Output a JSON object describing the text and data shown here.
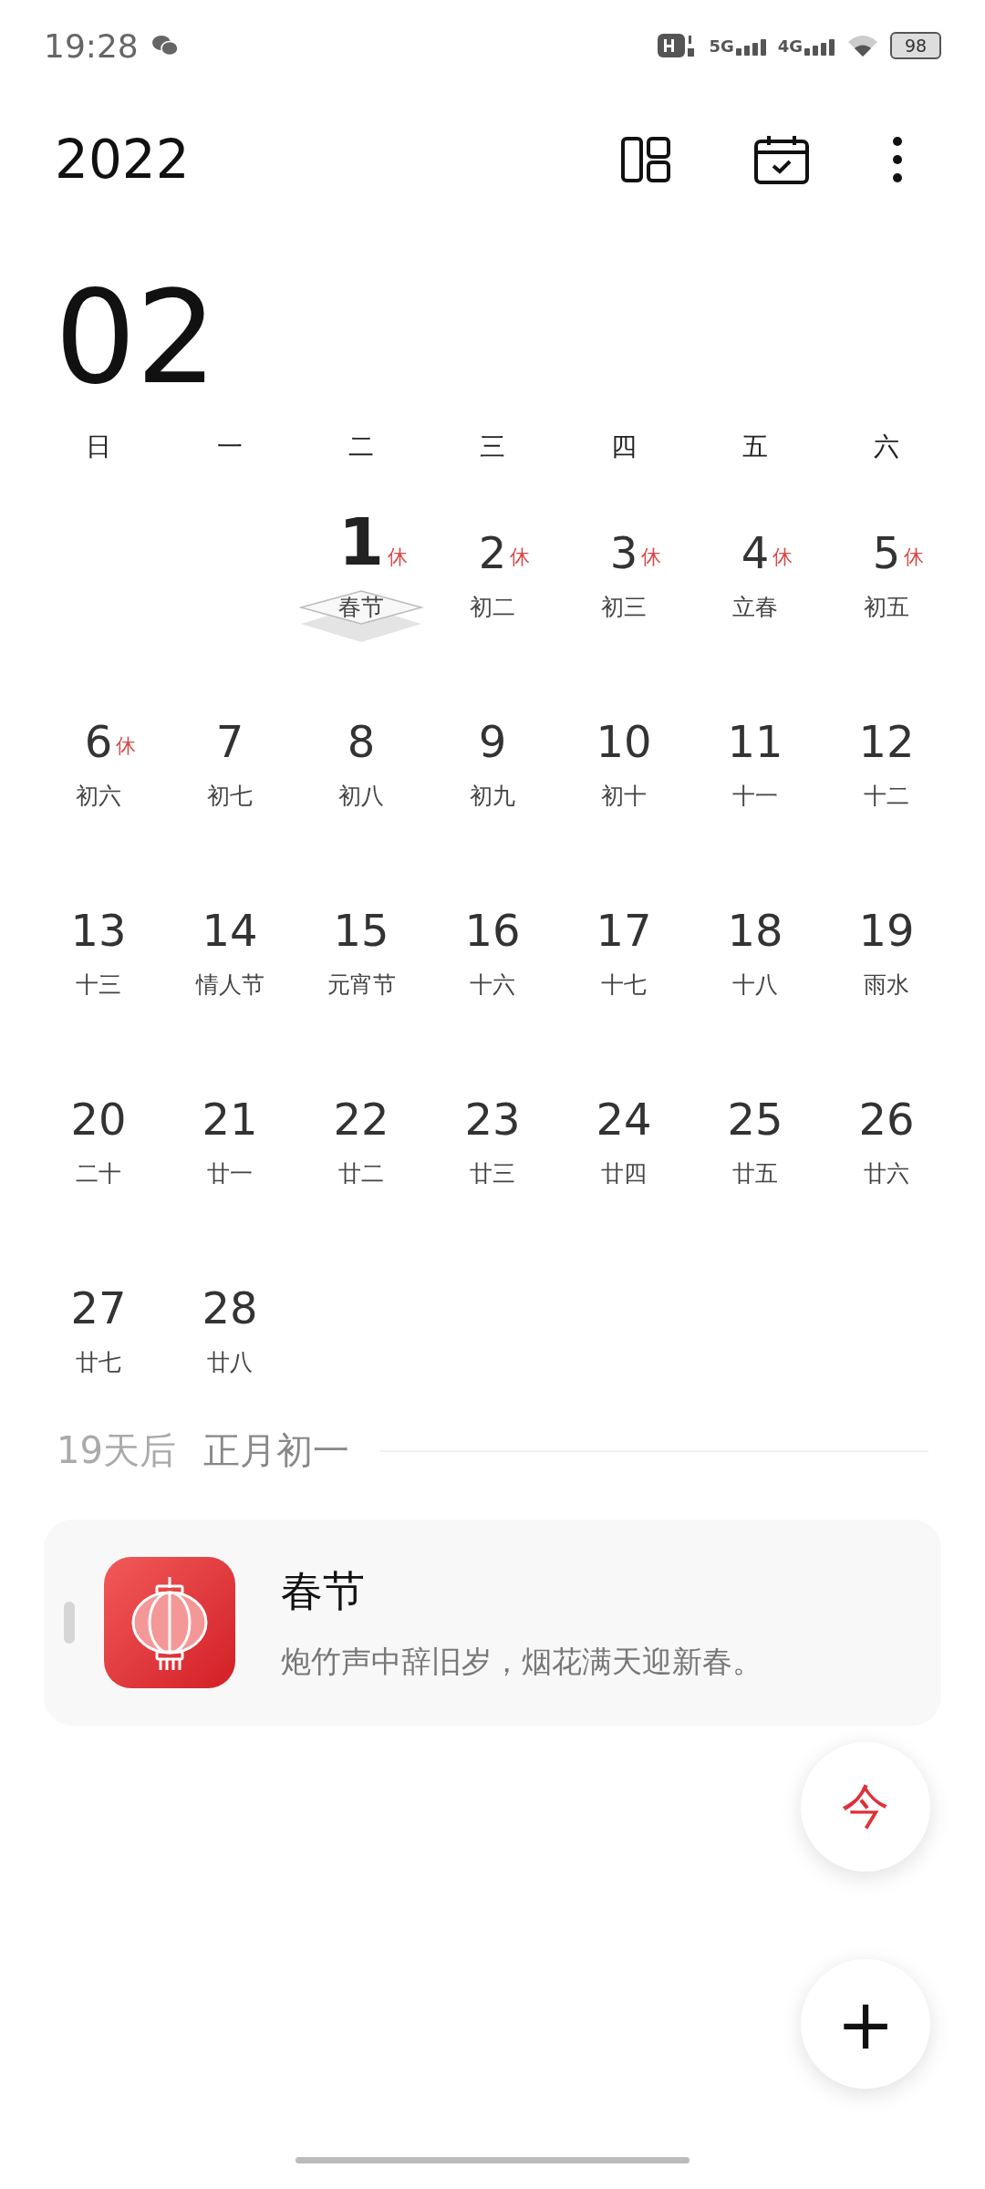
{
  "status_bar": {
    "time": "19:28",
    "network_labels": [
      "5G",
      "4G"
    ],
    "battery": "98"
  },
  "header": {
    "year": "2022"
  },
  "month": "02",
  "weekdays": [
    "日",
    "一",
    "二",
    "三",
    "四",
    "五",
    "六"
  ],
  "weeks": [
    [
      {
        "kind": "empty"
      },
      {
        "kind": "empty"
      },
      {
        "kind": "day",
        "day": "1",
        "lunar": "春节",
        "badge": "休",
        "selected": true
      },
      {
        "kind": "day",
        "day": "2",
        "lunar": "初二",
        "badge": "休",
        "selected": false
      },
      {
        "kind": "day",
        "day": "3",
        "lunar": "初三",
        "badge": "休",
        "selected": false
      },
      {
        "kind": "day",
        "day": "4",
        "lunar": "立春",
        "badge": "休",
        "selected": false
      },
      {
        "kind": "day",
        "day": "5",
        "lunar": "初五",
        "badge": "休",
        "selected": false
      }
    ],
    [
      {
        "kind": "day",
        "day": "6",
        "lunar": "初六",
        "badge": "休",
        "selected": false
      },
      {
        "kind": "day",
        "day": "7",
        "lunar": "初七",
        "selected": false
      },
      {
        "kind": "day",
        "day": "8",
        "lunar": "初八",
        "selected": false
      },
      {
        "kind": "day",
        "day": "9",
        "lunar": "初九",
        "selected": false
      },
      {
        "kind": "day",
        "day": "10",
        "lunar": "初十",
        "selected": false
      },
      {
        "kind": "day",
        "day": "11",
        "lunar": "十一",
        "selected": false
      },
      {
        "kind": "day",
        "day": "12",
        "lunar": "十二",
        "selected": false
      }
    ],
    [
      {
        "kind": "day",
        "day": "13",
        "lunar": "十三",
        "selected": false
      },
      {
        "kind": "day",
        "day": "14",
        "lunar": "情人节",
        "selected": false
      },
      {
        "kind": "day",
        "day": "15",
        "lunar": "元宵节",
        "selected": false
      },
      {
        "kind": "day",
        "day": "16",
        "lunar": "十六",
        "selected": false
      },
      {
        "kind": "day",
        "day": "17",
        "lunar": "十七",
        "selected": false
      },
      {
        "kind": "day",
        "day": "18",
        "lunar": "十八",
        "selected": false
      },
      {
        "kind": "day",
        "day": "19",
        "lunar": "雨水",
        "selected": false
      }
    ],
    [
      {
        "kind": "day",
        "day": "20",
        "lunar": "二十",
        "selected": false
      },
      {
        "kind": "day",
        "day": "21",
        "lunar": "廿一",
        "selected": false
      },
      {
        "kind": "day",
        "day": "22",
        "lunar": "廿二",
        "selected": false
      },
      {
        "kind": "day",
        "day": "23",
        "lunar": "廿三",
        "selected": false
      },
      {
        "kind": "day",
        "day": "24",
        "lunar": "廿四",
        "selected": false
      },
      {
        "kind": "day",
        "day": "25",
        "lunar": "廿五",
        "selected": false
      },
      {
        "kind": "day",
        "day": "26",
        "lunar": "廿六",
        "selected": false
      }
    ],
    [
      {
        "kind": "day",
        "day": "27",
        "lunar": "廿七",
        "selected": false
      },
      {
        "kind": "day",
        "day": "28",
        "lunar": "廿八",
        "selected": false
      }
    ]
  ],
  "summary": {
    "countdown": "19天后",
    "lunar_date": "正月初一"
  },
  "event": {
    "title": "春节",
    "subtitle": "炮竹声中辞旧岁，烟花满天迎新春。"
  },
  "fabs": [
    {
      "kind": "today",
      "label": "今"
    },
    {
      "kind": "add",
      "label": "+"
    }
  ]
}
